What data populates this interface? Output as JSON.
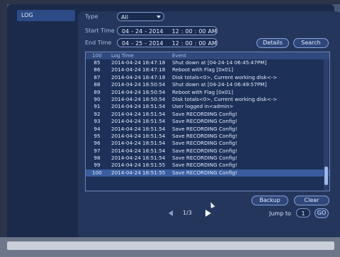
{
  "tab": {
    "label": "LOG"
  },
  "filters": {
    "type_label": "Type",
    "type_value": "All",
    "start_label": "Start Time",
    "start": {
      "month": "04",
      "day": "24",
      "year": "2014",
      "h": "12",
      "m": "00",
      "s": "00",
      "ampm": "AM"
    },
    "end_label": "End Time",
    "end": {
      "month": "04",
      "day": "25",
      "year": "2014",
      "h": "12",
      "m": "00",
      "s": "00",
      "ampm": "AM"
    },
    "details_label": "Details",
    "search_label": "Search"
  },
  "table": {
    "headers": {
      "count": "100",
      "time": "Log Time",
      "event": "Event"
    },
    "rows": [
      {
        "n": "85",
        "time": "2014-04-24 18:47:18",
        "event": "Shut down at [04-24-14 06:45:47PM]"
      },
      {
        "n": "86",
        "time": "2014-04-24 18:47:18",
        "event": "Reboot with Flag [0x01]"
      },
      {
        "n": "87",
        "time": "2014-04-24 18:47:18",
        "event": "Disk totals<0>, Current working disk<->"
      },
      {
        "n": "88",
        "time": "2014-04-24 18:50:54",
        "event": "Shut down at [04-24-14 06:49:57PM]"
      },
      {
        "n": "89",
        "time": "2014-04-24 18:50:54",
        "event": "Reboot with Flag [0x01]"
      },
      {
        "n": "90",
        "time": "2014-04-24 18:50:54",
        "event": "Disk totals<0>, Current working disk<->"
      },
      {
        "n": "91",
        "time": "2014-04-24 18:51:54",
        "event": "User logged in<admin>"
      },
      {
        "n": "92",
        "time": "2014-04-24 18:51:54",
        "event": "Save RECORDING Config!"
      },
      {
        "n": "93",
        "time": "2014-04-24 18:51:54",
        "event": "Save RECORDING Config!"
      },
      {
        "n": "94",
        "time": "2014-04-24 18:51:54",
        "event": "Save RECORDING Config!"
      },
      {
        "n": "95",
        "time": "2014-04-24 18:51:54",
        "event": "Save RECORDING Config!"
      },
      {
        "n": "96",
        "time": "2014-04-24 18:51:54",
        "event": "Save RECORDING Config!"
      },
      {
        "n": "97",
        "time": "2014-04-24 18:51:54",
        "event": "Save RECORDING Config!"
      },
      {
        "n": "98",
        "time": "2014-04-24 18:51:54",
        "event": "Save RECORDING Config!"
      },
      {
        "n": "99",
        "time": "2014-04-24 18:51:55",
        "event": "Save RECORDING Config!"
      },
      {
        "n": "100",
        "time": "2014-04-24 18:51:55",
        "event": "Save RECORDING Config!"
      }
    ],
    "selected_row": "100"
  },
  "actions": {
    "backup_label": "Backup",
    "clear_label": "Clear"
  },
  "pager": {
    "page": "1/3",
    "jump_label": "Jump to",
    "jump_value": "1",
    "go_label": "GO"
  },
  "icons": {
    "prev": "prev-arrow-icon",
    "next": "next-arrow-icon",
    "dropdown": "dropdown-arrow-icon",
    "cursor": "mouse-cursor-icon"
  }
}
